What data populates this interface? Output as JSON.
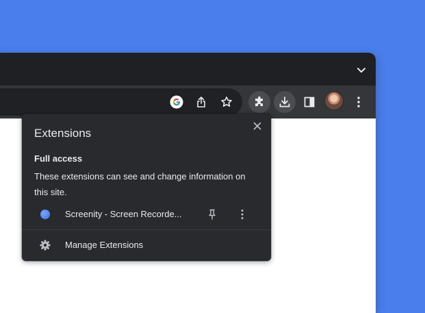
{
  "colors": {
    "desktop": "#4a7eec",
    "tabstrip": "#1f2023",
    "toolbar": "#35363a",
    "popup_bg": "#292a2d",
    "text": "#e8eaed"
  },
  "toolbar": {
    "icons": [
      "google-lens-icon",
      "share-icon",
      "bookmark-star-icon",
      "extensions-puzzle-icon",
      "download-icon",
      "side-panel-icon",
      "profile-avatar",
      "kebab-menu-icon"
    ]
  },
  "popup": {
    "title": "Extensions",
    "section_title": "Full access",
    "section_description": "These extensions can see and change information on this site.",
    "extensions": [
      {
        "name": "Screenity - Screen Recorde...",
        "icon": "screenity-icon"
      }
    ],
    "manage_label": "Manage Extensions"
  }
}
